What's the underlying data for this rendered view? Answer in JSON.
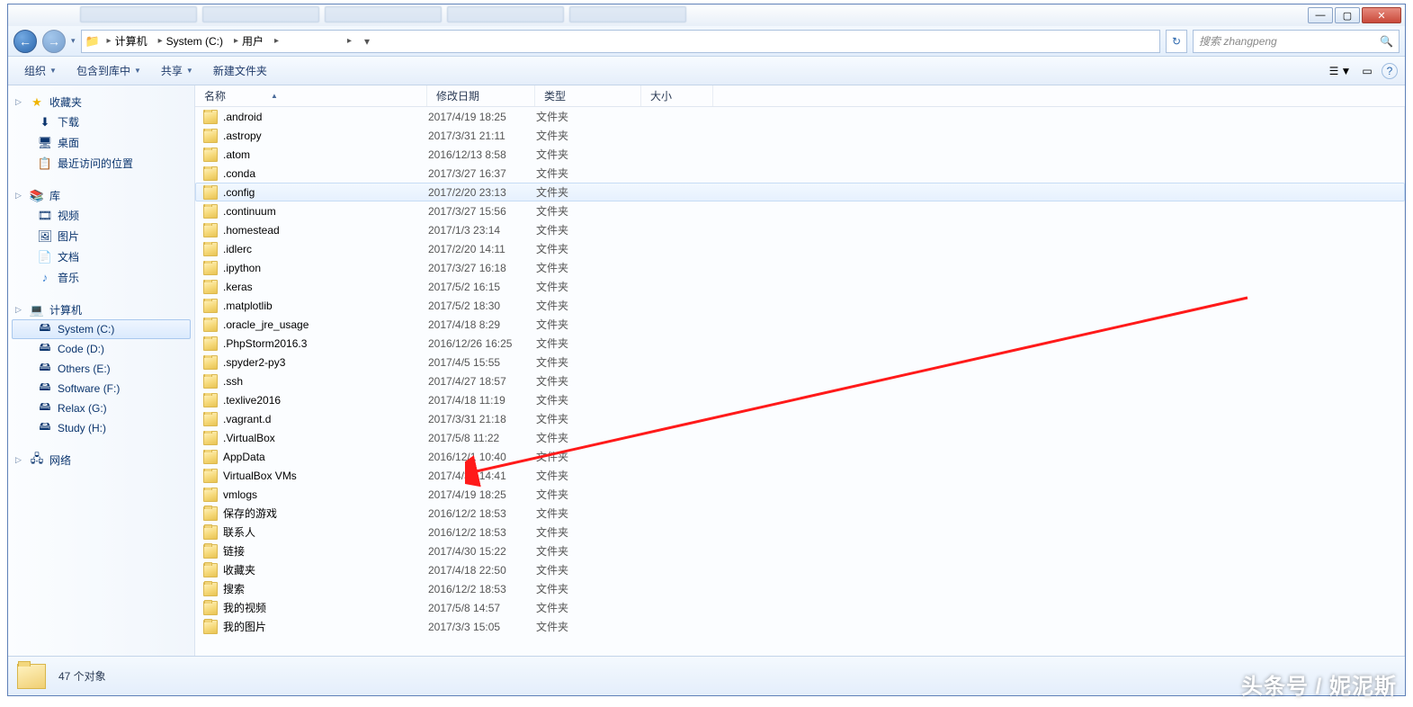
{
  "window": {
    "minimize_glyph": "—",
    "maximize_glyph": "▢",
    "close_glyph": "✕"
  },
  "nav": {
    "back_glyph": "←",
    "forward_glyph": "→",
    "drop_glyph": "▾",
    "refresh_glyph": "↻",
    "folder_icon_glyph": "📁"
  },
  "breadcrumbs": [
    {
      "label": "计算机"
    },
    {
      "label": "System (C:)"
    },
    {
      "label": "用户"
    },
    {
      "label": ""
    },
    {
      "label": ""
    }
  ],
  "search": {
    "placeholder": "搜索 zhangpeng",
    "icon_glyph": "🔍"
  },
  "toolbar": {
    "organize": "组织",
    "include": "包含到库中",
    "share": "共享",
    "newfolder": "新建文件夹",
    "view_glyph": "☰",
    "preview_glyph": "▭",
    "help_glyph": "?"
  },
  "sidebar": {
    "favorites": {
      "label": "收藏夹",
      "icon": "★"
    },
    "downloads": {
      "label": "下载",
      "icon": "⬇"
    },
    "desktop": {
      "label": "桌面",
      "icon": "🖥"
    },
    "recent": {
      "label": "最近访问的位置",
      "icon": "📋"
    },
    "libraries": {
      "label": "库",
      "icon": "📚"
    },
    "videos": {
      "label": "视频",
      "icon": "🎞"
    },
    "pictures": {
      "label": "图片",
      "icon": "🖼"
    },
    "documents": {
      "label": "文档",
      "icon": "📄"
    },
    "music": {
      "label": "音乐",
      "icon": "♪"
    },
    "computer": {
      "label": "计算机",
      "icon": "💻"
    },
    "drive_c": {
      "label": "System (C:)",
      "icon": "🖴"
    },
    "drive_d": {
      "label": "Code (D:)",
      "icon": "🖴"
    },
    "drive_e": {
      "label": "Others (E:)",
      "icon": "🖴"
    },
    "drive_f": {
      "label": "Software (F:)",
      "icon": "🖴"
    },
    "drive_g": {
      "label": "Relax (G:)",
      "icon": "🖴"
    },
    "drive_h": {
      "label": "Study (H:)",
      "icon": "🖴"
    },
    "network": {
      "label": "网络",
      "icon": "🖧"
    }
  },
  "columns": {
    "name": "名称",
    "date": "修改日期",
    "type": "类型",
    "size": "大小",
    "sort_glyph": "▲"
  },
  "type_folder": "文件夹",
  "files": [
    {
      "name": ".android",
      "date": "2017/4/19 18:25"
    },
    {
      "name": ".astropy",
      "date": "2017/3/31 21:11"
    },
    {
      "name": ".atom",
      "date": "2016/12/13 8:58"
    },
    {
      "name": ".conda",
      "date": "2017/3/27 16:37"
    },
    {
      "name": ".config",
      "date": "2017/2/20 23:13",
      "selected": true
    },
    {
      "name": ".continuum",
      "date": "2017/3/27 15:56"
    },
    {
      "name": ".homestead",
      "date": "2017/1/3 23:14"
    },
    {
      "name": ".idlerc",
      "date": "2017/2/20 14:11"
    },
    {
      "name": ".ipython",
      "date": "2017/3/27 16:18"
    },
    {
      "name": ".keras",
      "date": "2017/5/2 16:15"
    },
    {
      "name": ".matplotlib",
      "date": "2017/5/2 18:30"
    },
    {
      "name": ".oracle_jre_usage",
      "date": "2017/4/18 8:29"
    },
    {
      "name": ".PhpStorm2016.3",
      "date": "2016/12/26 16:25"
    },
    {
      "name": ".spyder2-py3",
      "date": "2017/4/5 15:55"
    },
    {
      "name": ".ssh",
      "date": "2017/4/27 18:57"
    },
    {
      "name": ".texlive2016",
      "date": "2017/4/18 11:19"
    },
    {
      "name": ".vagrant.d",
      "date": "2017/3/31 21:18"
    },
    {
      "name": ".VirtualBox",
      "date": "2017/5/8 11:22"
    },
    {
      "name": "AppData",
      "date": "2016/12/1 10:40"
    },
    {
      "name": "VirtualBox VMs",
      "date": "2017/4/30 14:41"
    },
    {
      "name": "vmlogs",
      "date": "2017/4/19 18:25"
    },
    {
      "name": "保存的游戏",
      "date": "2016/12/2 18:53"
    },
    {
      "name": "联系人",
      "date": "2016/12/2 18:53"
    },
    {
      "name": "链接",
      "date": "2017/4/30 15:22"
    },
    {
      "name": "收藏夹",
      "date": "2017/4/18 22:50"
    },
    {
      "name": "搜索",
      "date": "2016/12/2 18:53"
    },
    {
      "name": "我的视频",
      "date": "2017/5/8 14:57"
    },
    {
      "name": "我的图片",
      "date": "2017/3/3 15:05"
    }
  ],
  "status": {
    "count_text": "47 个对象"
  },
  "watermark": "头条号 / 妮泥斯"
}
